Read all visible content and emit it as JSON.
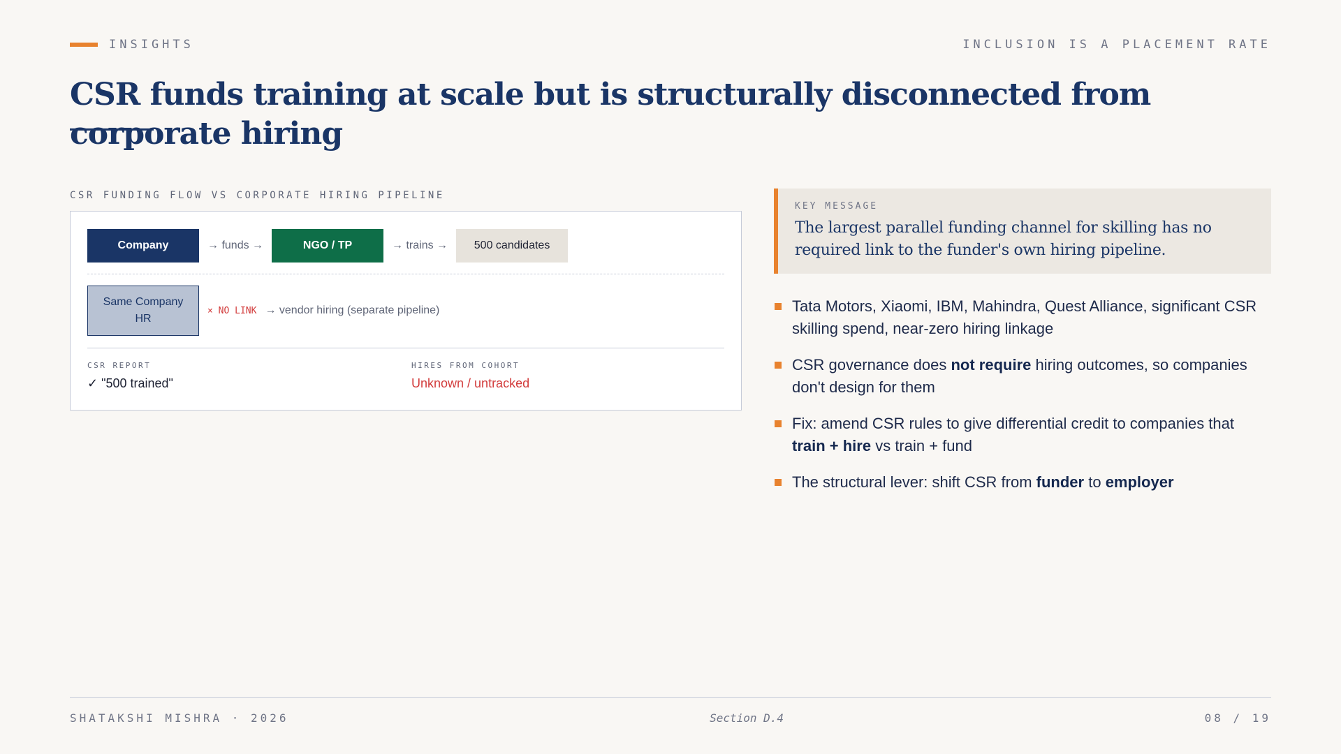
{
  "header": {
    "section_label": "INSIGHTS",
    "deck_tag": "INCLUSION IS A PLACEMENT RATE"
  },
  "title": "CSR funds training at scale but is structurally disconnected from corporate hiring",
  "diagram": {
    "caption": "CSR FUNDING FLOW VS CORPORATE HIRING PIPELINE",
    "flow": {
      "company": "Company",
      "funds_connector": "→ funds →",
      "ngo": "NGO / TP",
      "trains_connector": "→ trains →",
      "candidates": "500 candidates"
    },
    "hr_row": {
      "hr_line1": "Same Company",
      "hr_line2": "HR",
      "no_link": "× NO LINK",
      "vendor": "→ vendor hiring (separate pipeline)"
    },
    "stats": {
      "csr_report_label": "CSR REPORT",
      "csr_report_value": "✓ \"500 trained\"",
      "hires_label": "HIRES FROM COHORT",
      "hires_value": "Unknown / untracked"
    }
  },
  "key_message": {
    "label": "KEY MESSAGE",
    "text": "The largest parallel funding channel for skilling has no required link to the funder's own hiring pipeline."
  },
  "bullets": [
    {
      "parts": [
        {
          "t": "Tata Motors, Xiaomi, IBM, Mahindra, Quest Alliance, significant CSR skilling spend, near-zero hiring linkage",
          "b": false
        }
      ]
    },
    {
      "parts": [
        {
          "t": "CSR governance does ",
          "b": false
        },
        {
          "t": "not require",
          "b": true
        },
        {
          "t": " hiring outcomes, so companies don't design for them",
          "b": false
        }
      ]
    },
    {
      "parts": [
        {
          "t": "Fix: amend CSR rules to give differential credit to companies that ",
          "b": false
        },
        {
          "t": "train + hire",
          "b": true
        },
        {
          "t": " vs train + fund",
          "b": false
        }
      ]
    },
    {
      "parts": [
        {
          "t": "The structural lever: shift CSR from ",
          "b": false
        },
        {
          "t": "funder",
          "b": true
        },
        {
          "t": " to ",
          "b": false
        },
        {
          "t": "employer",
          "b": true
        }
      ]
    }
  ],
  "footer": {
    "author": "SHATAKSHI MISHRA · 2026",
    "section": "Section D.4",
    "page": "08 / 19"
  },
  "colors": {
    "navy": "#1a3566",
    "orange": "#e8822e",
    "green": "#0e6e48",
    "red": "#d23b3b"
  }
}
